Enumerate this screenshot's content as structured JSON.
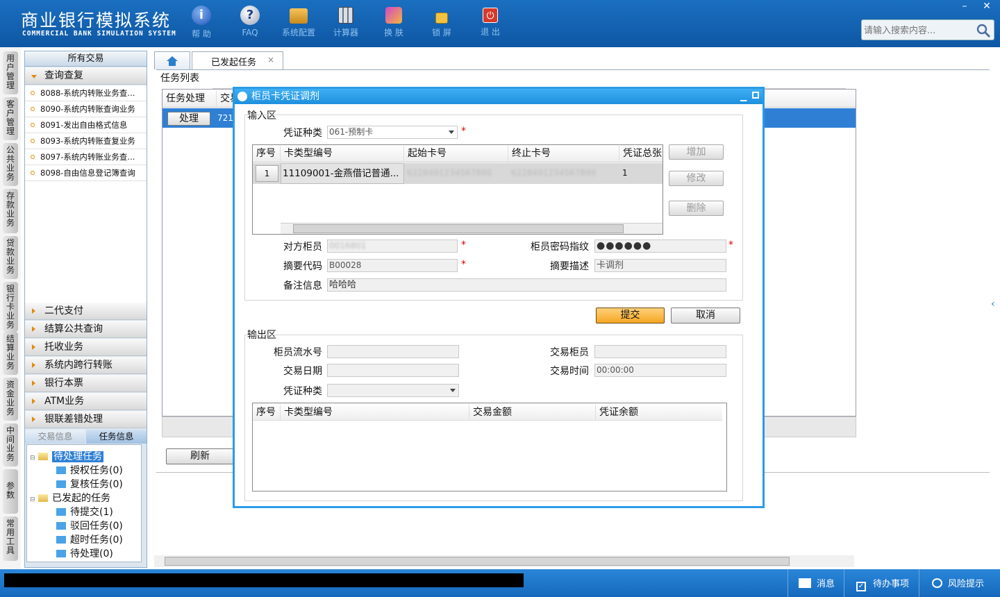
{
  "header": {
    "title_cn": "商业银行模拟系统",
    "title_en": "COMMERCIAL BANK SIMULATION SYSTEM",
    "toolbar": [
      {
        "label": "帮 助",
        "icon": "help-icon"
      },
      {
        "label": "FAQ",
        "icon": "faq-icon"
      },
      {
        "label": "系统配置",
        "icon": "toolbox-icon"
      },
      {
        "label": "计算器",
        "icon": "calculator-icon"
      },
      {
        "label": "换 肤",
        "icon": "shirt-icon"
      },
      {
        "label": "锁 屏",
        "icon": "lock-icon"
      },
      {
        "label": "退 出",
        "icon": "power-icon"
      }
    ],
    "search_placeholder": "请输入搜索内容...",
    "window_min": "–",
    "window_close": "✕"
  },
  "vtabs": [
    "用户管理",
    "客户管理",
    "公共业务",
    "存款业务",
    "贷款业务",
    "银行卡业务",
    "结算业务",
    "资金业务",
    "中间业务",
    "参数",
    "常用工具"
  ],
  "nav": {
    "header": "所有交易",
    "open_menu": "查询查复",
    "sub_items": [
      "8088-系统内转账业务查...",
      "8090-系统内转账查询业务",
      "8091-发出自由格式信息",
      "8093-系统内转账查复业务",
      "8097-系统内转账业务查...",
      "8098-自由信息登记簿查询"
    ],
    "menus": [
      "二代支付",
      "结算公共查询",
      "托收业务",
      "系统内跨行转账",
      "银行本票",
      "ATM业务",
      "银联差错处理"
    ],
    "info_tabs": [
      "交易信息",
      "任务信息"
    ],
    "tree": {
      "pending": "待处理任务",
      "auth": "授权任务(0)",
      "review": "复核任务(0)",
      "initiated": "已发起的任务",
      "to_submit": "待提交(1)",
      "rejected": "驳回任务(0)",
      "timeout": "超时任务(0)",
      "to_process": "待处理(0)"
    }
  },
  "content": {
    "tab_label": "已发起任务",
    "tab_close": "×",
    "section_title": "任务列表",
    "col_task": "任务处理",
    "col_trade": "交易",
    "process_btn": "处理",
    "row_code": "721(",
    "refresh_btn": "刷新"
  },
  "dialog": {
    "title": "柜员卡凭证调剂",
    "input_section": "输入区",
    "voucher_type_label": "凭证种类",
    "voucher_type_value": "061-预制卡",
    "table_headers": [
      "序号",
      "卡类型编号",
      "起始卡号",
      "终止卡号",
      "凭证总张"
    ],
    "table_row": {
      "seq": "1",
      "type": "11109001-金燕借记普通...",
      "start": "6228491234567890",
      "end": "6228491234567899",
      "total": "1"
    },
    "add_btn": "增加",
    "edit_btn": "修改",
    "delete_btn": "删除",
    "counterpart_label": "对方柜员",
    "counterpart_value": "0016801",
    "pwd_label": "柜员密码指纹",
    "pwd_value": "●●●●●●",
    "summary_code_label": "摘要代码",
    "summary_code_value": "B00028",
    "summary_desc_label": "摘要描述",
    "summary_desc_value": "卡调剂",
    "remark_label": "备注信息",
    "remark_value": "哈哈哈",
    "submit_btn": "提交",
    "cancel_btn": "取消",
    "output_section": "输出区",
    "teller_serial_label": "柜员流水号",
    "trade_teller_label": "交易柜员",
    "trade_date_label": "交易日期",
    "trade_time_label": "交易时间",
    "trade_time_value": "00:00:00",
    "out_voucher_label": "凭证种类",
    "out_headers": [
      "序号",
      "卡类型编号",
      "交易金额",
      "凭证余额"
    ]
  },
  "status": {
    "msg": "消息",
    "todo": "待办事项",
    "risk": "风险提示"
  }
}
